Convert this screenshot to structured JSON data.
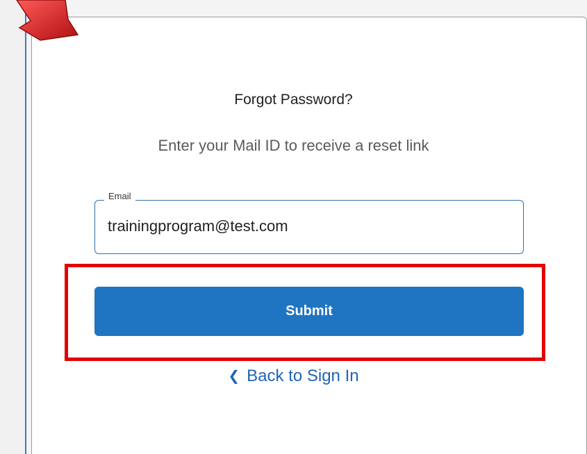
{
  "page": {
    "title": "Forgot Password?",
    "subtitle": "Enter your Mail ID to receive a reset link"
  },
  "form": {
    "email_label": "Email",
    "email_value": "trainingprogram@test.com",
    "submit_label": "Submit"
  },
  "links": {
    "back_label": "Back to Sign In",
    "back_icon": "chevron-left-icon"
  },
  "annotation": {
    "highlight_color": "#e30000",
    "arrow_color": "#d62222"
  },
  "colors": {
    "primary": "#1f75c1",
    "link": "#1f64b7",
    "field_border": "#2f6fae"
  }
}
